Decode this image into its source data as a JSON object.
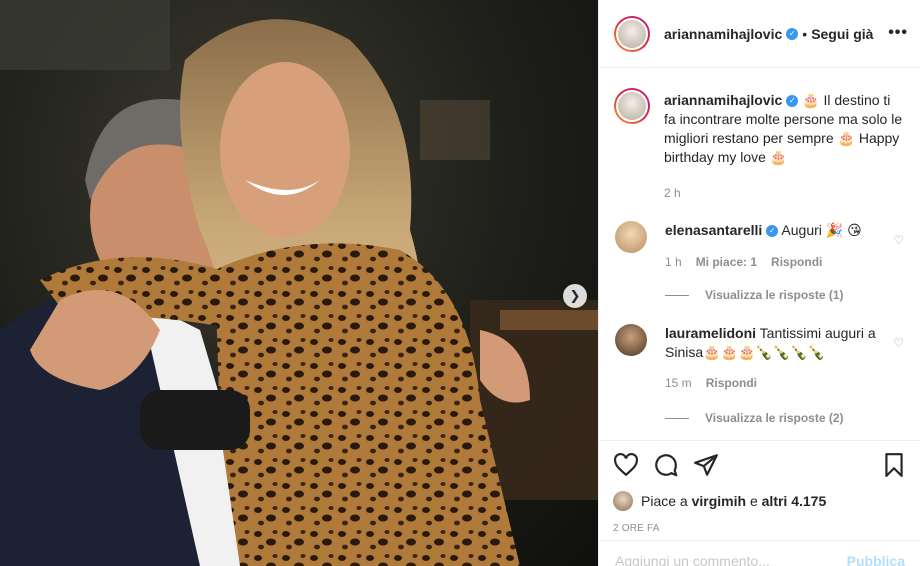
{
  "post": {
    "author": "ariannamihajlovic",
    "follow_label": "Segui già",
    "more_label": "•••",
    "caption": "🎂 Il destino ti fa incontrare molte persone ma solo le migliori restano per sempre 🎂 Happy birthday my love 🎂",
    "caption_time": "2 h"
  },
  "comments": [
    {
      "user": "elenasantarelli",
      "verified": true,
      "text": "Auguri 🎉 😘",
      "time": "1 h",
      "likes": "Mi piace: 1",
      "reply_label": "Rispondi",
      "view_replies": "Visualizza le risposte (1)"
    },
    {
      "user": "lauramelidoni",
      "verified": false,
      "text": "Tantissimi auguri a Sinisa🎂🎂🎂🍾🍾🍾🍾",
      "time": "15 m",
      "reply_label": "Rispondi",
      "view_replies": "Visualizza le risposte (2)"
    }
  ],
  "actions": {
    "likes_text": "Piace a virgimih e altri 4.175",
    "liker": "virgimih",
    "others": "altri 4.175",
    "time_ago": "2 ORE FA"
  },
  "add_comment": {
    "placeholder": "Aggiungi un commento...",
    "publish": "Pubblica"
  },
  "icons": {
    "like": "heart-icon",
    "comment": "comment-bubble-icon",
    "share": "paper-plane-icon",
    "save": "bookmark-icon",
    "next": "chevron-right-icon",
    "verified": "verified-badge-icon"
  },
  "colors": {
    "verified": "#3897f0",
    "text": "#262626",
    "muted": "#8e8e8e",
    "divider": "#efefef"
  }
}
